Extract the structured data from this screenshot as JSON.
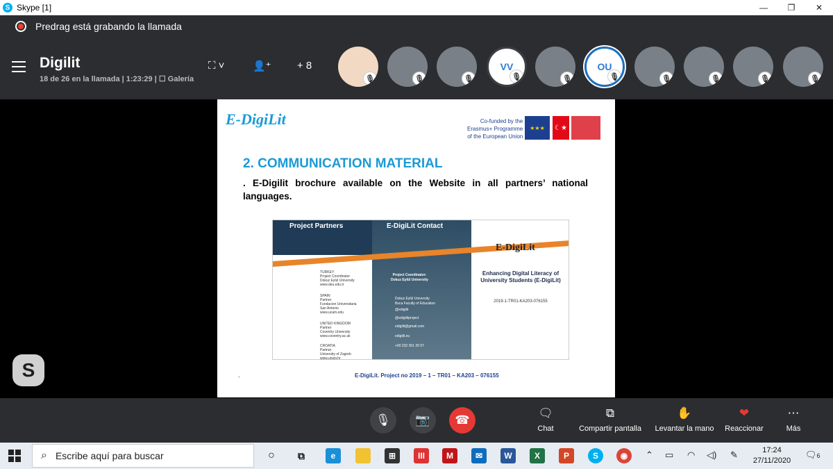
{
  "window": {
    "title": "Skype [1]",
    "minimize": "—",
    "maximize": "❐",
    "close": "✕"
  },
  "recording": {
    "text": "Predrag está grabando la llamada"
  },
  "call": {
    "title": "Digilit",
    "info": "18 de 26 en la llamada | 1:23:29 | ☐ Galería",
    "more_count": "+ 8"
  },
  "participants": [
    {
      "initials": "",
      "kind": "cartoon"
    },
    {
      "initials": "",
      "kind": "photo"
    },
    {
      "initials": "",
      "kind": "photo"
    },
    {
      "initials": "VV",
      "kind": "initials"
    },
    {
      "initials": "",
      "kind": "photo"
    },
    {
      "initials": "OU",
      "kind": "initials"
    },
    {
      "initials": "",
      "kind": "photo"
    },
    {
      "initials": "",
      "kind": "photo"
    },
    {
      "initials": "",
      "kind": "photo"
    },
    {
      "initials": "",
      "kind": "photo"
    }
  ],
  "slide": {
    "logo": "E-DigiLit",
    "cofund": [
      "Co-funded by the",
      "Erasmus+ Programme",
      "of the European Union"
    ],
    "title": "2. COMMUNICATION MATERIAL",
    "body": ". E-Digilit brochure available on the Website in all partners’ national languages.",
    "footer": "E-DigiLit. Project no 2019 – 1 – TR01 – KA203 – 076155",
    "dot": ".",
    "brochure": {
      "h_partners": "Project Partners",
      "h_contact": "E-DigiLit Contact",
      "partners": [
        "TURKEY\nProject Coordinator\nDokuz Eylül University\nwww.deu.edu.tr",
        "SPAIN\nPartner\nFundacion Universitaria\nSan Antonio\nwww.ucam.edu",
        "UNITED KINGDOM\nPartner\nCoventry University\nwww.coventry.ac.uk",
        "CROATIA\nPartner\nUniversity of Zagreb\nwww.unizg.hr"
      ],
      "coordinator": "Project Coordinator:\nDokuz Eylül University",
      "contacts": [
        "Dokuz Eylül University\nBuca Faculty of Education",
        "@edigilit",
        "@edigilitproject",
        "edigilit@gmail.com",
        "edigilit.eu",
        "+90 232 301 20 07"
      ],
      "logo": "E-DigiLit",
      "right_title": "Enhancing Digital Literacy of University Students (E-DigiLit)",
      "code": "2019-1-TR01-KA203-076155"
    }
  },
  "controls": {
    "chat": "Chat",
    "share": "Compartir pantalla",
    "hand": "Levantar la mano",
    "react": "Reaccionar",
    "more": "Más"
  },
  "taskbar": {
    "search_placeholder": "Escribe aquí para buscar",
    "time": "17:24",
    "date": "27/11/2020",
    "notif": "6"
  }
}
